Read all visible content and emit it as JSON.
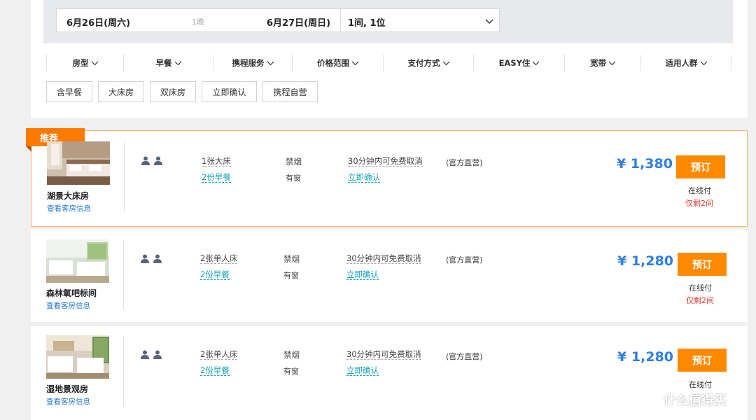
{
  "search": {
    "checkin": "6月26日(周六)",
    "nights": "1晚",
    "checkout": "6月27日(周日)",
    "guests": "1间, 1位"
  },
  "filters": [
    "房型",
    "早餐",
    "携程服务",
    "价格范围",
    "支付方式",
    "EASY住",
    "宽带",
    "适用人群"
  ],
  "tags": [
    "含早餐",
    "大床房",
    "双床房",
    "立即确认",
    "携程自营"
  ],
  "rooms": [
    {
      "badge": "推荐",
      "name": "湖景大床房",
      "info_link": "查看客房信息",
      "bed": "1张大床",
      "breakfast": "2份早餐",
      "smoking": "禁烟",
      "window": "有窗",
      "cancel": "30分钟内可免费取消",
      "confirm": "立即确认",
      "seller": "(官方直营)",
      "price": "¥ 1,380",
      "book": "预订",
      "pay": "在线付",
      "remaining": "仅剩2间"
    },
    {
      "name": "森林氧吧标间",
      "info_link": "查看客房信息",
      "bed": "2张单人床",
      "breakfast": "2份早餐",
      "smoking": "禁烟",
      "window": "有窗",
      "cancel": "30分钟内可免费取消",
      "confirm": "立即确认",
      "seller": "(官方直营)",
      "price": "¥ 1,280",
      "book": "预订",
      "pay": "在线付",
      "remaining": "仅剩2间"
    },
    {
      "name": "湿地景观房",
      "info_link": "查看客房信息",
      "bed": "2张单人床",
      "breakfast": "2份早餐",
      "smoking": "禁烟",
      "window": "有窗",
      "cancel": "30分钟内可免费取消",
      "confirm": "立即确认",
      "seller": "(官方直营)",
      "price": "¥ 1,280",
      "book": "预订",
      "pay": "在线付"
    }
  ],
  "watermark": "什么值得买",
  "colors": {
    "accent_orange": "#ff8a00",
    "price_blue": "#2f7fe0",
    "link_teal": "#15a2b5",
    "warning_red": "#e03a2f"
  }
}
